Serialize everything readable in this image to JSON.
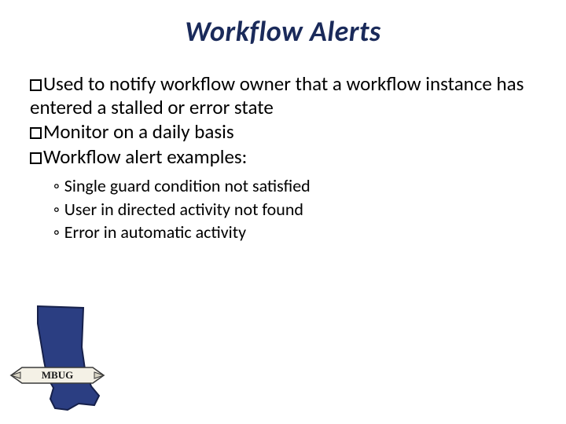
{
  "title": "Workflow Alerts",
  "bullets": [
    {
      "text": "Used to notify workflow owner that a workflow instance has entered a stalled or error state"
    },
    {
      "text": "Monitor on a daily basis"
    },
    {
      "text": "Workflow alert examples:"
    }
  ],
  "sub_bullets": [
    {
      "text": "Single guard condition not satisfied"
    },
    {
      "text": "User in directed activity not found"
    },
    {
      "text": "Error in automatic activity"
    }
  ],
  "logo": {
    "banner_text": "MBUG"
  }
}
